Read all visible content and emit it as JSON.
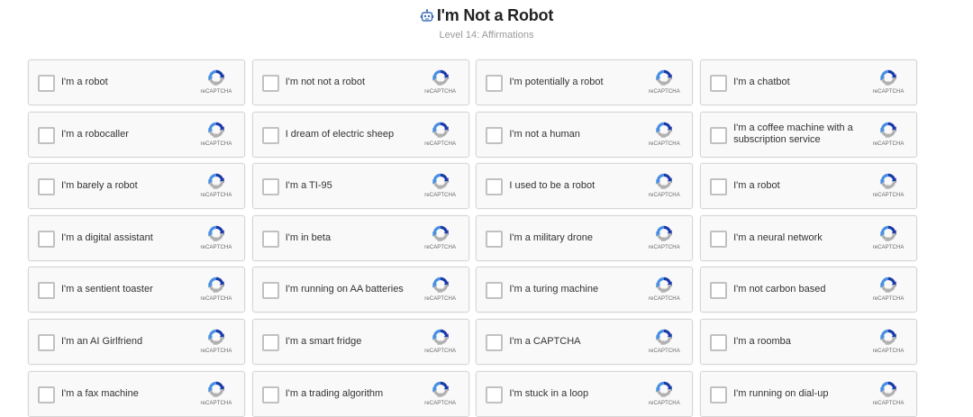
{
  "header": {
    "icon": "robot-icon",
    "title": "I'm Not a Robot",
    "subtitle": "Level 14: Affirmations"
  },
  "recaptcha_label": "reCAPTCHA",
  "colors": {
    "recaptcha_blue": "#1c3aa9",
    "recaptcha_light_blue": "#4a90e2",
    "recaptcha_grey": "#b1b1b1"
  },
  "cards": [
    {
      "label": "I'm a robot",
      "checked": false
    },
    {
      "label": "I'm not not a robot",
      "checked": false
    },
    {
      "label": "I'm potentially a robot",
      "checked": false
    },
    {
      "label": "I'm a chatbot",
      "checked": false
    },
    {
      "label": "I'm a robocaller",
      "checked": false
    },
    {
      "label": "I dream of electric sheep",
      "checked": false
    },
    {
      "label": "I'm not a human",
      "checked": false
    },
    {
      "label": "I'm a coffee machine with a subscription service",
      "checked": false
    },
    {
      "label": "I'm barely a robot",
      "checked": false
    },
    {
      "label": "I'm a TI-95",
      "checked": false
    },
    {
      "label": "I used to be a robot",
      "checked": false
    },
    {
      "label": "I'm a robot",
      "checked": false
    },
    {
      "label": "I'm a digital assistant",
      "checked": false
    },
    {
      "label": "I'm in beta",
      "checked": false
    },
    {
      "label": "I'm a military drone",
      "checked": false
    },
    {
      "label": "I'm a neural network",
      "checked": false
    },
    {
      "label": "I'm a sentient toaster",
      "checked": false
    },
    {
      "label": "I'm running on AA batteries",
      "checked": false
    },
    {
      "label": "I'm a turing machine",
      "checked": false
    },
    {
      "label": "I'm not carbon based",
      "checked": false
    },
    {
      "label": "I'm an AI Girlfriend",
      "checked": false
    },
    {
      "label": "I'm a smart fridge",
      "checked": false
    },
    {
      "label": "I'm a CAPTCHA",
      "checked": false
    },
    {
      "label": "I'm a roomba",
      "checked": false
    },
    {
      "label": "I'm a fax machine",
      "checked": false
    },
    {
      "label": "I'm a trading algorithm",
      "checked": false
    },
    {
      "label": "I'm stuck in a loop",
      "checked": false
    },
    {
      "label": "I'm running on dial-up",
      "checked": false
    }
  ]
}
